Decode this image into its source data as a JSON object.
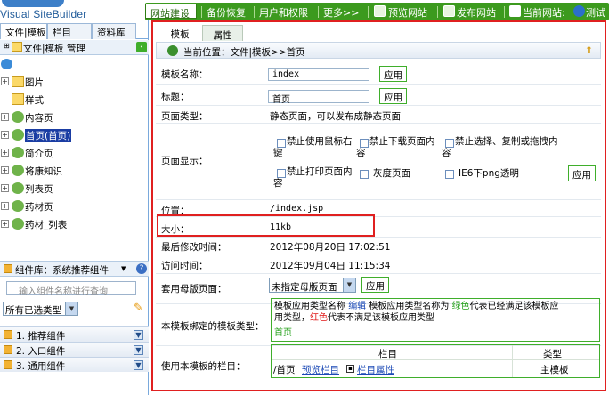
{
  "app": {
    "logo_text": "Visual SiteBuilder"
  },
  "topnav": {
    "active_tab": "网站建设",
    "items": [
      "备份恢复",
      "用户和权限",
      "更多>>"
    ],
    "preview": "预览网站",
    "publish": "发布网站",
    "current_site": "当前网站:",
    "site_name": "测试"
  },
  "sidebar": {
    "tabs": [
      "文件|模板",
      "栏目",
      "资料库"
    ],
    "panel_title": "文件|模板 管理",
    "tree": [
      {
        "label": "图片",
        "selected": false
      },
      {
        "label": "样式",
        "selected": false
      },
      {
        "label": "内容页",
        "selected": false
      },
      {
        "label": "首页(首页)",
        "selected": true
      },
      {
        "label": "简介页",
        "selected": false
      },
      {
        "label": "将康知识",
        "selected": false
      },
      {
        "label": "列表页",
        "selected": false
      },
      {
        "label": "药材页",
        "selected": false
      },
      {
        "label": "药材_列表",
        "selected": false
      }
    ],
    "component_lib": "组件库：系统推荐组件",
    "search_placeholder": "输入组件名称进行查询",
    "type_select": "所有已选类型",
    "groups": [
      "1. 推荐组件",
      "2. 入口组件",
      "3. 通用组件"
    ]
  },
  "main": {
    "tabs": [
      "模板",
      "属性"
    ],
    "breadcrumb": "当前位置：文件|模板>>首页",
    "apply_label": "应用",
    "fields": {
      "template_name_label": "模板名称：",
      "template_name_value": "index",
      "title_label": "标题：",
      "title_value": "首页",
      "page_type_label": "页面类型：",
      "page_type_value": "静态页面，可以发布成静态页面",
      "page_display_label": "页面显示：",
      "options": [
        "禁止使用鼠标右键",
        "禁止下载页面内容",
        "禁止选择、复制或拖拽内容",
        "禁止打印页面内容",
        "灰度页面",
        "IE6下png透明"
      ],
      "location_label": "位置：",
      "location_value": "/index.jsp",
      "size_label": "大小：",
      "size_value": "11kb",
      "modified_label": "最后修改时间：",
      "modified_value": "2012年08月20日 17:02:51",
      "visited_label": "访问时间：",
      "visited_value": "2012年09月04日 11:15:34",
      "master_label": "套用母版页面：",
      "master_value": "未指定母版页面",
      "bound_label": "本模板绑定的模板类型：",
      "bound_line1a": "模板应用类型名称",
      "bound_edit": "编辑",
      "bound_line1b": "模板应用类型名称为",
      "bound_green": "绿色",
      "bound_line1c": "代表已经满足该模板应",
      "bound_line2a": "用类型，",
      "bound_red": "红色",
      "bound_line2b": "代表不满足该模板应用类型",
      "bound_item": "首页",
      "columns_label": "使用本模板的栏目：",
      "col_header": "栏目",
      "type_header": "类型",
      "col_path": "/首页",
      "col_preview": "预览栏目",
      "col_attr": "栏目属性",
      "col_type": "主模板"
    }
  },
  "colors": {
    "nav_green": "#3c9a1e",
    "highlight_red": "#e02020",
    "link_blue": "#1b49b6"
  }
}
